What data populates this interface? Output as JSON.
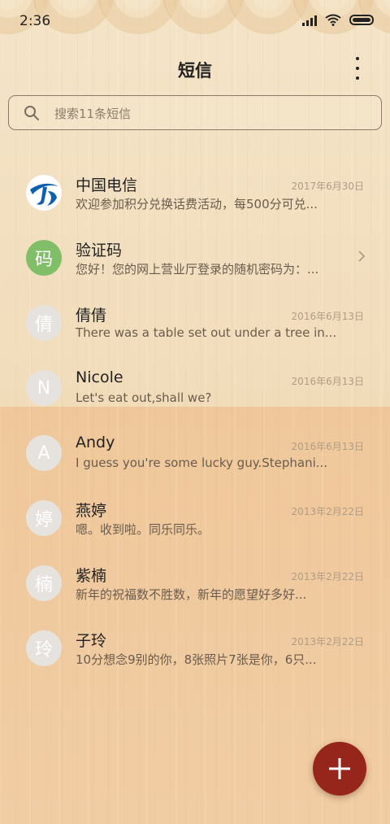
{
  "status_bar": {
    "time": "2:36"
  },
  "header": {
    "title": "短信"
  },
  "search": {
    "placeholder": "搜索11条短信"
  },
  "messages": [
    {
      "avatar": "",
      "name": "中国电信",
      "date": "2017年6月30日",
      "preview": "欢迎参加积分兑换话费活动，每500分可兑..."
    },
    {
      "avatar": "码",
      "name": "验证码",
      "date": "",
      "preview": "您好！您的网上营业厅登录的随机密码为：..."
    },
    {
      "avatar": "倩",
      "name": "倩倩",
      "date": "2016年6月13日",
      "preview": "There was a table set out under a tree in..."
    },
    {
      "avatar": "N",
      "name": "Nicole",
      "date": "2016年6月13日",
      "preview": "Let's eat out,shall we?"
    },
    {
      "avatar": "A",
      "name": "Andy",
      "date": "2016年6月13日",
      "preview": "I guess you're some lucky guy.Stephani..."
    },
    {
      "avatar": "婷",
      "name": "燕婷",
      "date": "2013年2月22日",
      "preview": "嗯。收到啦。同乐同乐。"
    },
    {
      "avatar": "楠",
      "name": "紫楠",
      "date": "2013年2月22日",
      "preview": "新年的祝福数不胜数，新年的愿望好多好..."
    },
    {
      "avatar": "玲",
      "name": "子玲",
      "date": "2013年2月22日",
      "preview": "10分想念9别的你，8张照片7张是你，6只..."
    }
  ],
  "colors": {
    "fab": "#96251c",
    "avatar_green": "#80bf68",
    "avatar_default": "#e6e3df",
    "telecom_blue": "#0d5fb0"
  },
  "icons": {
    "search": "search-icon",
    "more": "more-vertical-icon",
    "fab": "plus-icon",
    "chevron": "chevron-right-icon"
  }
}
